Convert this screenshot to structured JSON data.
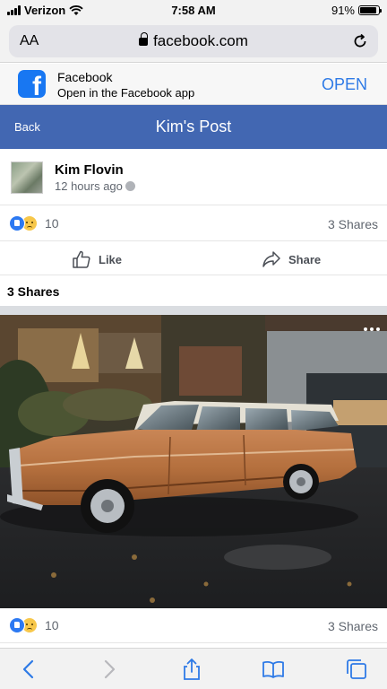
{
  "status_bar": {
    "carrier": "Verizon",
    "time": "7:58 AM",
    "battery": "91%"
  },
  "browser": {
    "text_size_label": "AA",
    "url": "facebook.com"
  },
  "app_banner": {
    "title": "Facebook",
    "subtitle": "Open in the Facebook app",
    "open_label": "OPEN"
  },
  "header": {
    "back_label": "Back",
    "title": "Kim's Post"
  },
  "post": {
    "author": "Kim Flovin",
    "timestamp": "12 hours ago",
    "reaction_count": "10",
    "shares_label": "3 Shares",
    "like_label": "Like",
    "share_label": "Share",
    "shares_heading": "3 Shares"
  },
  "colors": {
    "facebook_blue": "#4267b2",
    "link_blue": "#2e7ae6",
    "like_blue": "#2c79f2",
    "sad_yellow": "#f7c74a"
  },
  "icons": [
    "wifi-icon",
    "lock-icon",
    "reload-icon",
    "facebook-logo-icon",
    "globe-icon",
    "like-reaction-icon",
    "sad-reaction-icon",
    "thumbs-up-icon",
    "share-arrow-icon",
    "more-dots-icon",
    "back-chevron-icon",
    "forward-chevron-icon",
    "share-sheet-icon",
    "bookmarks-icon",
    "tabs-icon"
  ]
}
